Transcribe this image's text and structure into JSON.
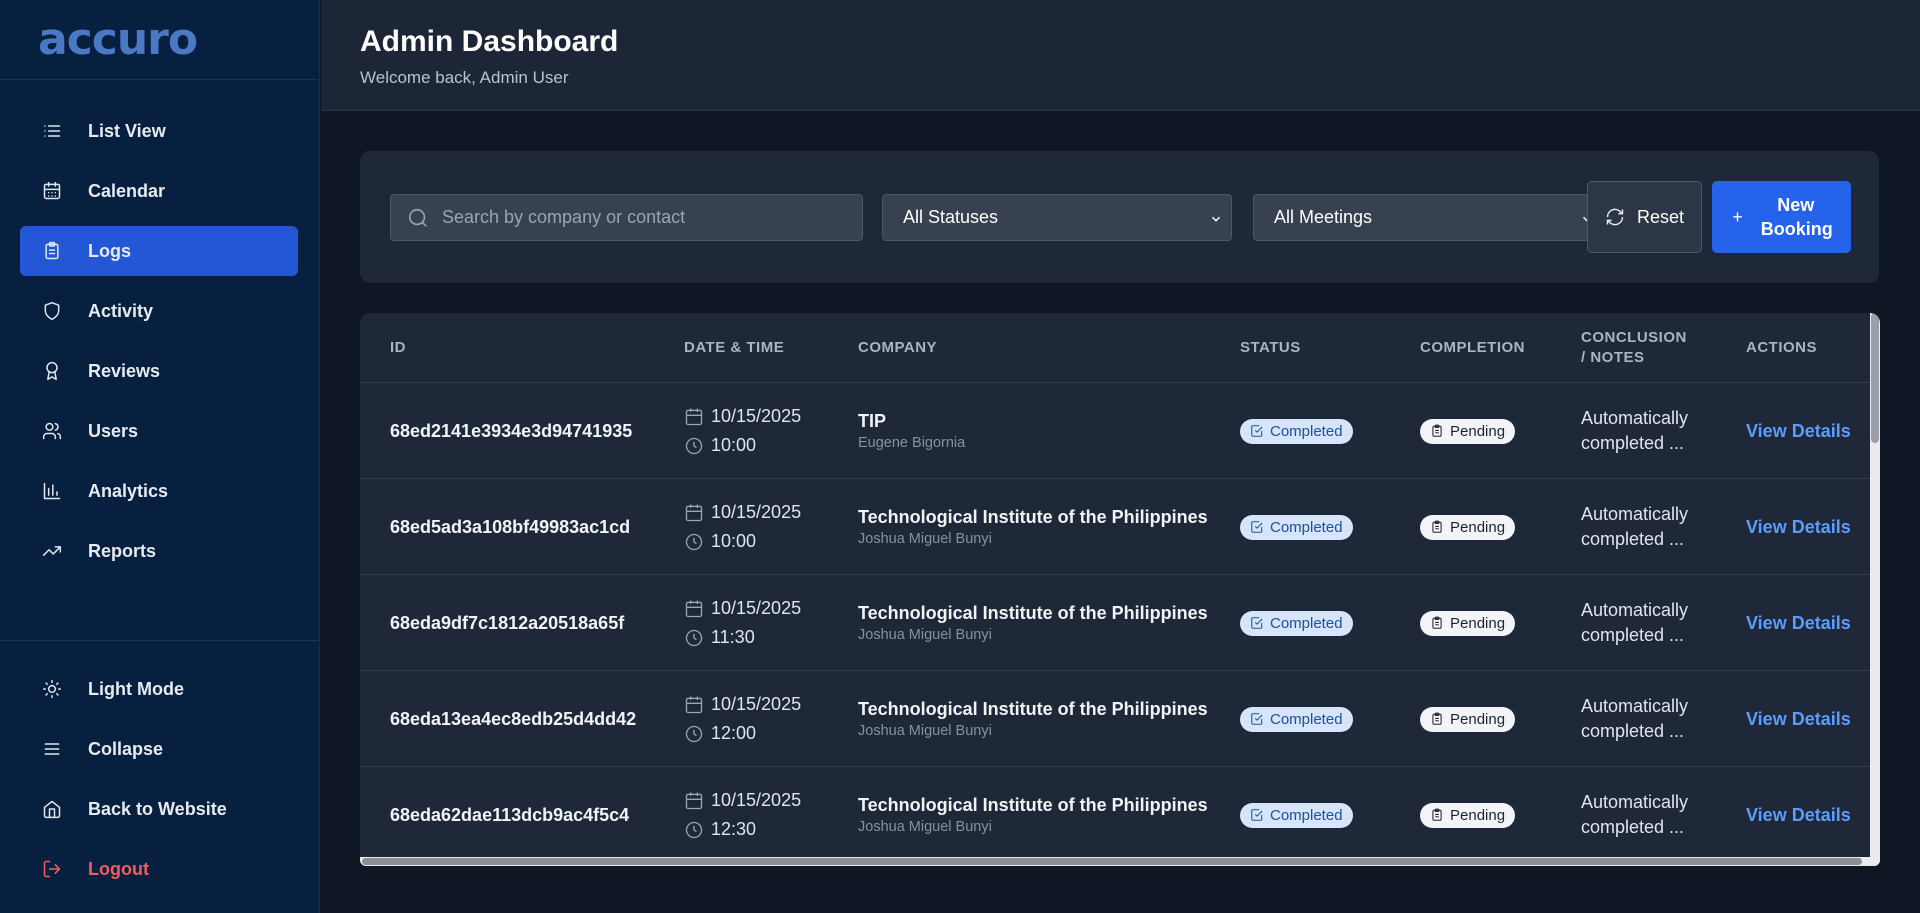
{
  "app": {
    "logo": "accuro"
  },
  "sidebar": {
    "items": [
      {
        "label": "List View",
        "icon": "list-icon"
      },
      {
        "label": "Calendar",
        "icon": "calendar-icon"
      },
      {
        "label": "Logs",
        "icon": "clipboard-icon",
        "active": true
      },
      {
        "label": "Activity",
        "icon": "shield-icon"
      },
      {
        "label": "Reviews",
        "icon": "award-icon"
      },
      {
        "label": "Users",
        "icon": "users-icon"
      },
      {
        "label": "Analytics",
        "icon": "bar-chart-icon"
      },
      {
        "label": "Reports",
        "icon": "trending-up-icon"
      }
    ],
    "bottom": [
      {
        "label": "Light Mode",
        "icon": "sun-icon"
      },
      {
        "label": "Collapse",
        "icon": "menu-icon"
      },
      {
        "label": "Back to Website",
        "icon": "home-icon"
      },
      {
        "label": "Logout",
        "icon": "logout-icon"
      }
    ]
  },
  "header": {
    "title": "Admin Dashboard",
    "subtitle": "Welcome back, Admin User"
  },
  "filters": {
    "search_placeholder": "Search by company or contact",
    "status_value": "All Statuses",
    "meetings_value": "All Meetings",
    "reset_label": "Reset",
    "new_plus": "+",
    "new_label": "New Booking"
  },
  "table": {
    "columns": {
      "id": "ID",
      "datetime": "DATE & TIME",
      "company": "COMPANY",
      "status": "STATUS",
      "completion": "COMPLETION",
      "conclusion": "CONCLUSION / NOTES",
      "actions": "ACTIONS"
    },
    "rows": [
      {
        "id": "68ed2141e3934e3d94741935",
        "date": "10/15/2025",
        "time": "10:00",
        "company": "TIP",
        "contact": "Eugene Bigornia",
        "status": "Completed",
        "completion": "Pending",
        "notes": "Automatically completed ...",
        "action": "View Details"
      },
      {
        "id": "68ed5ad3a108bf49983ac1cd",
        "date": "10/15/2025",
        "time": "10:00",
        "company": "Technological Institute of the Philippines",
        "contact": "Joshua Miguel Bunyi",
        "status": "Completed",
        "completion": "Pending",
        "notes": "Automatically completed ...",
        "action": "View Details"
      },
      {
        "id": "68eda9df7c1812a20518a65f",
        "date": "10/15/2025",
        "time": "11:30",
        "company": "Technological Institute of the Philippines",
        "contact": "Joshua Miguel Bunyi",
        "status": "Completed",
        "completion": "Pending",
        "notes": "Automatically completed ...",
        "action": "View Details"
      },
      {
        "id": "68eda13ea4ec8edb25d4dd42",
        "date": "10/15/2025",
        "time": "12:00",
        "company": "Technological Institute of the Philippines",
        "contact": "Joshua Miguel Bunyi",
        "status": "Completed",
        "completion": "Pending",
        "notes": "Automatically completed ...",
        "action": "View Details"
      },
      {
        "id": "68eda62dae113dcb9ac4f5c4",
        "date": "10/15/2025",
        "time": "12:30",
        "company": "Technological Institute of the Philippines",
        "contact": "Joshua Miguel Bunyi",
        "status": "Completed",
        "completion": "Pending",
        "notes": "Automatically completed ...",
        "action": "View Details"
      }
    ]
  },
  "colors": {
    "accent": "#2563eb",
    "sidebar_bg": "#07203f",
    "logout": "#f25c5c",
    "link": "#5b9cff"
  }
}
